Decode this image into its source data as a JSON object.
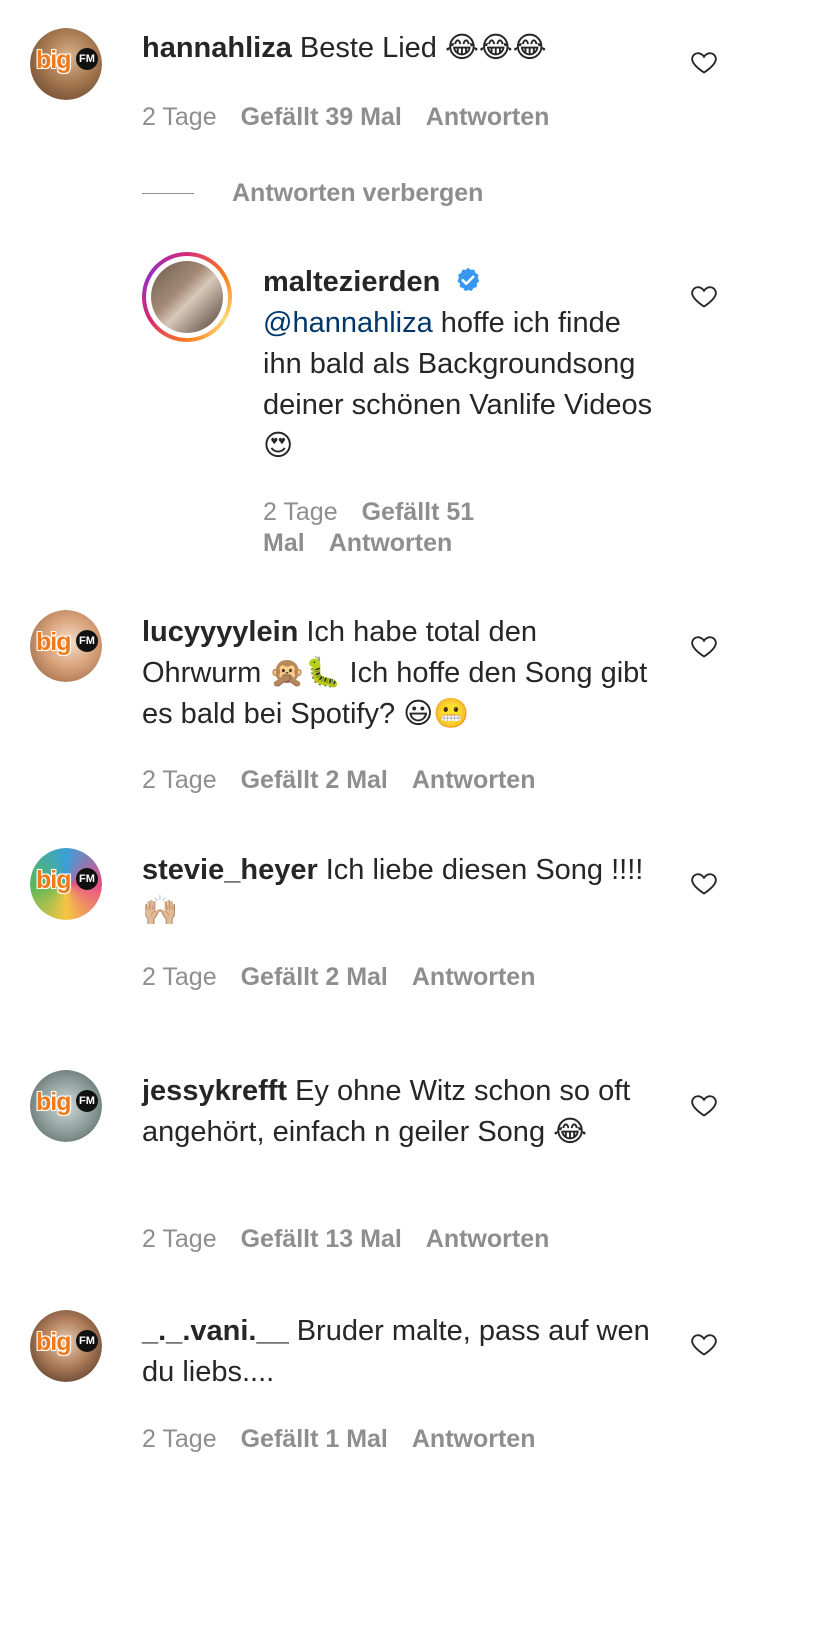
{
  "colors": {
    "text": "#262626",
    "meta": "#8e8e8e",
    "mention": "#00376b",
    "brand_orange": "#f07a1a",
    "verified_blue": "#3897f0"
  },
  "comments": [
    {
      "username": "hannahliza",
      "text": "Beste Lied 😂😂😂",
      "time": "2 Tage",
      "likes": "Gefällt 39 Mal",
      "reply": "Antworten",
      "avatar_badge": "big",
      "avatar_fm": "FM"
    },
    {
      "username": "maltezierden",
      "mention": "@hannahliza",
      "text": "hoffe ich finde ihn bald als Backgroundsong deiner schönen Vanlife Videos 😍",
      "time": "2 Tage",
      "likes": "Gefällt 51 Mal",
      "reply": "Antworten"
    },
    {
      "username": "lucyyyylein",
      "text": "Ich habe total den Ohrwurm 🙊🐛 Ich hoffe den Song gibt es bald bei Spotify? 😃😬",
      "time": "2 Tage",
      "likes": "Gefällt 2 Mal",
      "reply": "Antworten",
      "avatar_badge": "big",
      "avatar_fm": "FM"
    },
    {
      "username": "stevie_heyer",
      "text": "Ich liebe diesen Song !!!! 🙌🏼",
      "time": "2 Tage",
      "likes": "Gefällt 2 Mal",
      "reply": "Antworten",
      "avatar_badge": "big",
      "avatar_fm": "FM"
    },
    {
      "username": "jessykrefft",
      "text": "Ey ohne Witz schon so oft angehört, einfach n geiler Song 😂",
      "time": "2 Tage",
      "likes": "Gefällt 13 Mal",
      "reply": "Antworten",
      "avatar_badge": "big",
      "avatar_fm": "FM"
    },
    {
      "username": "_._.vani.__",
      "text": "Bruder malte, pass auf wen du liebs....",
      "time": "2 Tage",
      "likes": "Gefällt 1 Mal",
      "reply": "Antworten",
      "avatar_badge": "big",
      "avatar_fm": "FM"
    }
  ],
  "hide_replies_label": "Antworten verbergen"
}
